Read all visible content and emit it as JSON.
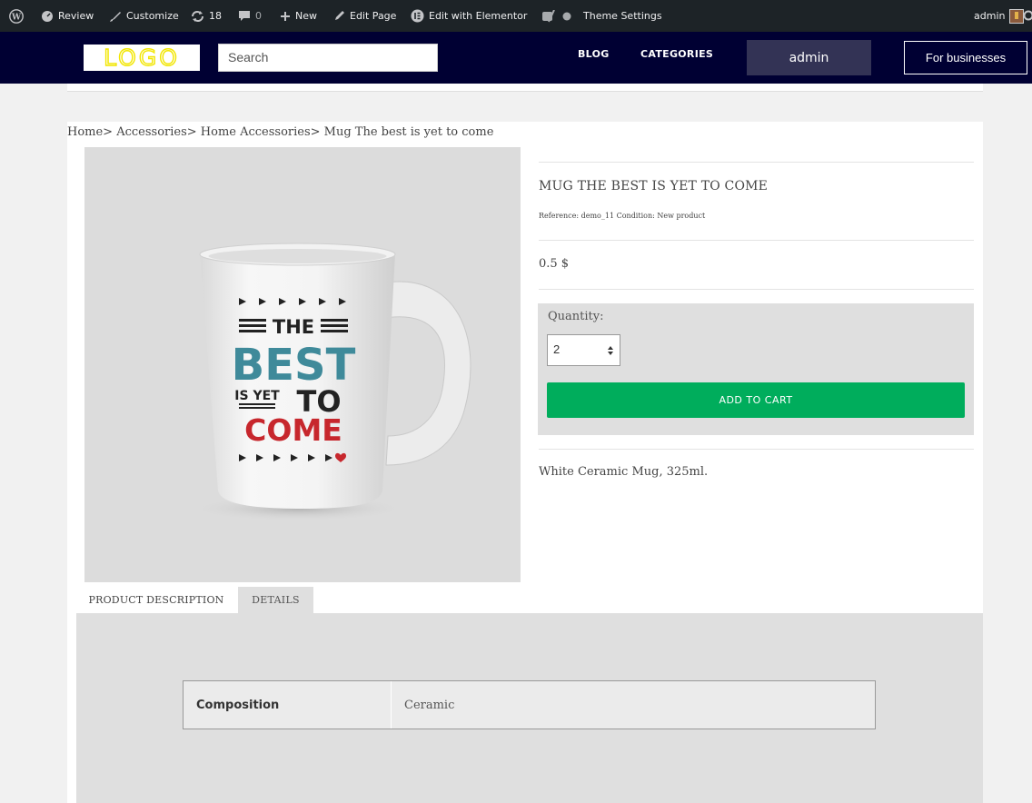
{
  "admin_bar": {
    "review": "Review",
    "customize": "Customize",
    "updates_count": "18",
    "comments_count": "0",
    "new": "New",
    "edit_page": "Edit Page",
    "edit_elementor": "Edit with Elementor",
    "theme_settings": "Theme Settings",
    "user": "admin"
  },
  "header": {
    "logo": "LOGO",
    "search_placeholder": "Search",
    "nav": [
      "BLOG",
      "CATEGORIES"
    ],
    "admin_button": "admin",
    "business_button": "For businesses"
  },
  "breadcrumb": "Home> Accessories> Home Accessories> Mug The best is yet to come",
  "product": {
    "title": "MUG THE BEST IS YET TO COME",
    "reference": "Reference: demo_11 Condition: New product",
    "price": "0.5 $",
    "quantity_label": "Quantity:",
    "quantity_value": "2",
    "add_to_cart": "ADD TO CART",
    "short_description": "White Ceramic Mug, 325ml.",
    "mug_print": {
      "line1": "THE",
      "line2": "BEST",
      "line3a": "IS YET",
      "line3b": "TO",
      "line4": "COME"
    }
  },
  "tabs": [
    {
      "label": "PRODUCT DESCRIPTION",
      "active": true
    },
    {
      "label": "DETAILS",
      "active": false
    }
  ],
  "details": [
    {
      "key": "Composition",
      "value": "Ceramic"
    }
  ],
  "colors": {
    "admin_bar": "#1d2327",
    "header": "#000033",
    "accent_green": "#00ad5c",
    "logo_yellow": "#f2e600"
  }
}
